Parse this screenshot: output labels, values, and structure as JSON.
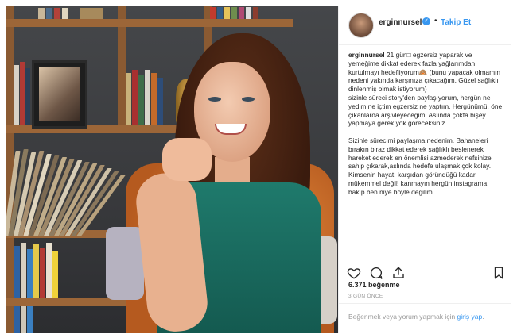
{
  "post": {
    "username": "erginnursel",
    "follow_label": "Takip Et",
    "separator": "•",
    "caption_user": "erginnursel",
    "caption_text": " 21 gün□ egzersiz yaparak ve yemeğime dikkat ederek fazla yağlarımdan kurtulmayı hedefliyorum🙈 (bunu yapacak olmamın nedeni yakında karşınıza çıkacağım. Güzel sağlıklı dinlenmiş olmak istiyorum)\nsizinle süreci story'den paylaşıyorum, hergün ne yedim ne içtim egzersiz ne yaptım. Hergünümü, öne çıkanlarda arşivleyeceğim. Aslında çokta bişey yapmaya gerek yok göreceksiniz.\n\nSizinle sürecimi paylaşma nedenim. Bahaneleri bırakın biraz dikkat ederek sağlıklı beslenerek hareket ederek en önemlisi azmederek nefsinize sahip çıkarak,aslında hedefe ulaşmak çok kolay. Kimsenin hayatı karşıdan göründüğü kadar mükemmel değil! kanmayın hergün instagrama bakıp ben niye böyle değilim",
    "likes": "6.371 beğenme",
    "date": "3 GÜN ÖNCE",
    "comment_prefix": "Beğenmek veya yorum yapmak için ",
    "comment_link": "giriş yap",
    "comment_suffix": "."
  },
  "icons": {
    "verified": "verified-badge-icon",
    "like": "heart-icon",
    "comment": "comment-icon",
    "share": "share-icon",
    "save": "bookmark-icon"
  },
  "colors": {
    "link": "#3897f0",
    "text": "#262626",
    "muted": "#999999",
    "border": "#efefef"
  }
}
